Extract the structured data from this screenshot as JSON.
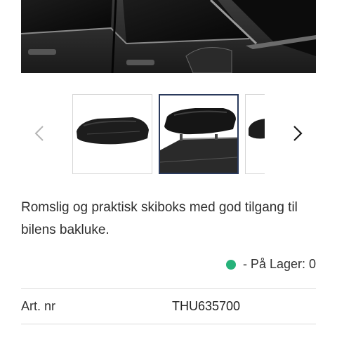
{
  "product": {
    "description": "Romslig og praktisk skiboks med god tilgang til bilens bakluke.",
    "stock_text": "- På Lager: 0",
    "stock_color": "#26b27a"
  },
  "gallery": {
    "prev_icon": "chevron-left-icon",
    "next_icon": "chevron-right-icon",
    "thumbnails": [
      {
        "description": "roof-box-thumbnail",
        "active": false
      },
      {
        "description": "roof-box-on-car-thumbnail",
        "active": true
      },
      {
        "description": "roof-box-partial-thumbnail",
        "active": false
      }
    ]
  },
  "specs": [
    {
      "label": "Art. nr",
      "value": "THU635700"
    }
  ],
  "colors": {
    "active_border": "#2a3a5c",
    "divider": "#dcdcdc"
  }
}
